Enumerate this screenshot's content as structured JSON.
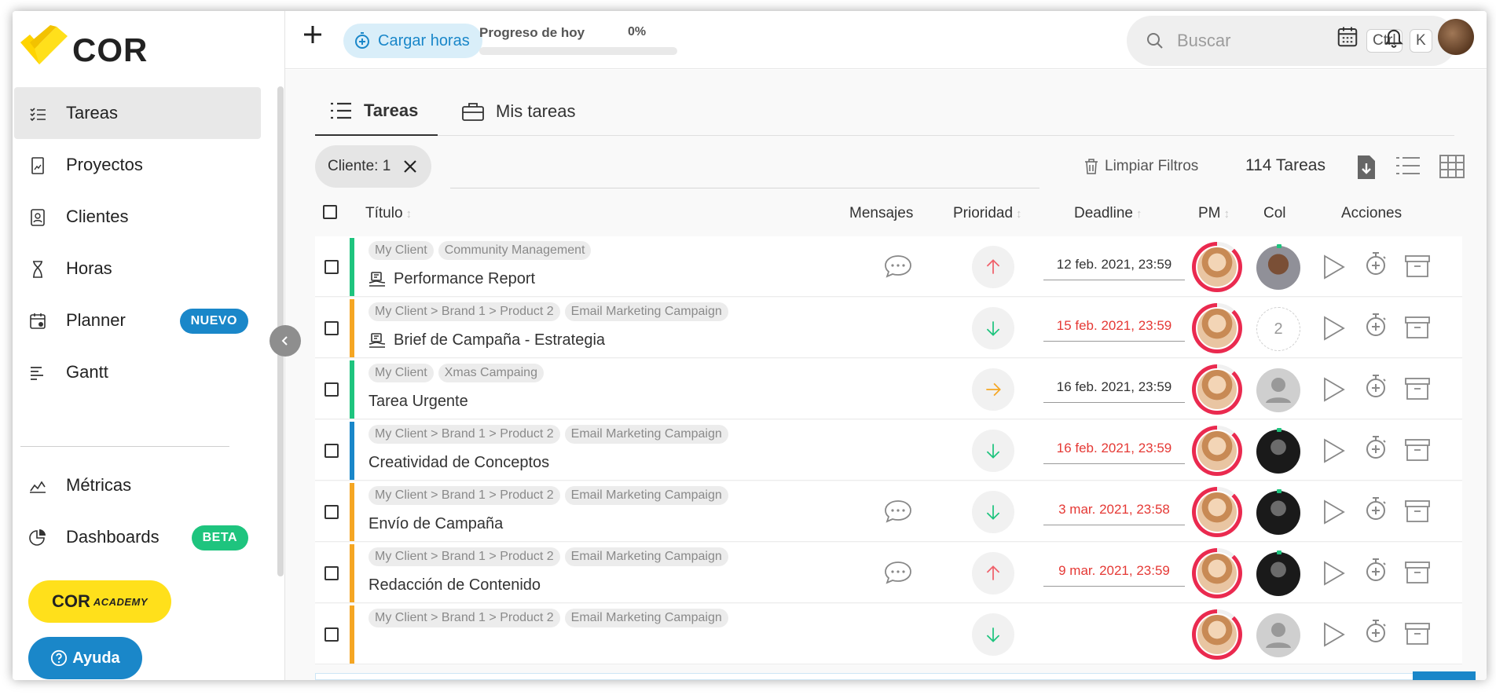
{
  "brand": {
    "logo_text": "COR"
  },
  "sidebar": {
    "items": [
      {
        "label": "Tareas",
        "icon": "checklist-icon",
        "active": true
      },
      {
        "label": "Proyectos",
        "icon": "project-icon"
      },
      {
        "label": "Clientes",
        "icon": "contacts-icon"
      },
      {
        "label": "Horas",
        "icon": "hourglass-icon"
      },
      {
        "label": "Planner",
        "icon": "calendar-user-icon",
        "badge": "NUEVO"
      },
      {
        "label": "Gantt",
        "icon": "gantt-icon"
      },
      {
        "label": "Métricas",
        "icon": "chart-icon"
      },
      {
        "label": "Dashboards",
        "icon": "pie-chart-icon",
        "badge": "BETA"
      }
    ],
    "academy": {
      "main": "COR",
      "sub": "ACADEMY"
    },
    "help_label": "Ayuda"
  },
  "topbar": {
    "load_hours_label": "Cargar horas",
    "progress_label": "Progreso de hoy",
    "progress_value": "0%",
    "progress_fraction": 0,
    "search_placeholder": "Buscar",
    "shortcut_keys": [
      "Ctrl",
      "K"
    ]
  },
  "tabs": [
    {
      "label": "Tareas",
      "active": true
    },
    {
      "label": "Mis tareas"
    }
  ],
  "filters": {
    "chip_label": "Cliente: 1",
    "clear_label": "Limpiar Filtros",
    "count_label": "114 Tareas"
  },
  "table": {
    "headers": {
      "title": "Título",
      "messages": "Mensajes",
      "priority": "Prioridad",
      "deadline": "Deadline",
      "pm": "PM",
      "col": "Col",
      "actions": "Acciones"
    },
    "rows": [
      {
        "tags": [
          "My Client",
          "Community Management"
        ],
        "title": "Performance Report",
        "has_icon": true,
        "messages": true,
        "priority": "high",
        "deadline": "12 feb. 2021, 23:59",
        "late": false,
        "bar": "#1ec47e",
        "col": "man"
      },
      {
        "tags": [
          "My Client > Brand 1 > Product 2",
          "Email Marketing Campaign"
        ],
        "title": "Brief de Campaña - Estrategia",
        "has_icon": true,
        "messages": false,
        "priority": "low",
        "deadline": "15 feb. 2021, 23:59",
        "late": true,
        "bar": "#f5a623",
        "col": "count",
        "col_count": "2"
      },
      {
        "tags": [
          "My Client",
          "Xmas Campaing"
        ],
        "title": "Tarea Urgente",
        "has_icon": false,
        "messages": false,
        "priority": "medium",
        "deadline": "16 feb. 2021, 23:59",
        "late": false,
        "bar": "#1ec47e",
        "col": "grey"
      },
      {
        "tags": [
          "My Client > Brand 1 > Product 2",
          "Email Marketing Campaign"
        ],
        "title": "Creatividad de Conceptos",
        "has_icon": false,
        "messages": false,
        "priority": "low",
        "deadline": "16 feb. 2021, 23:59",
        "late": true,
        "bar": "#1a87c9",
        "col": "dark"
      },
      {
        "tags": [
          "My Client > Brand 1 > Product 2",
          "Email Marketing Campaign"
        ],
        "title": "Envío de Campaña",
        "has_icon": false,
        "messages": true,
        "priority": "low",
        "deadline": "3 mar. 2021, 23:58",
        "late": true,
        "bar": "#f5a623",
        "col": "dark"
      },
      {
        "tags": [
          "My Client > Brand 1 > Product 2",
          "Email Marketing Campaign"
        ],
        "title": "Redacción de Contenido",
        "has_icon": false,
        "messages": true,
        "priority": "high",
        "deadline": "9 mar. 2021, 23:59",
        "late": true,
        "bar": "#f5a623",
        "col": "dark"
      },
      {
        "tags": [
          "My Client > Brand 1 > Product 2",
          "Email Marketing Campaign"
        ],
        "title": "",
        "has_icon": false,
        "messages": false,
        "priority": "low",
        "deadline": "",
        "late": false,
        "bar": "#f5a623",
        "col": "grey"
      }
    ]
  },
  "colors": {
    "accent": "#1a87c9",
    "late": "#e53935",
    "priority_high": "#f0606a",
    "priority_low": "#1ec47e",
    "priority_medium": "#f5a623"
  }
}
